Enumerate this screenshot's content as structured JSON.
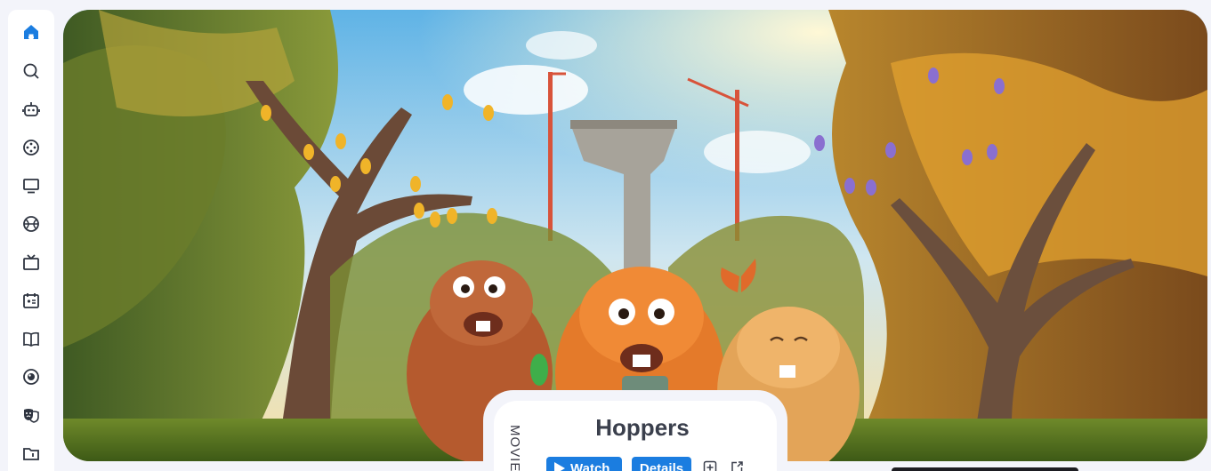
{
  "sidebar": {
    "items": [
      {
        "icon": "home-icon",
        "active": true
      },
      {
        "icon": "search-icon"
      },
      {
        "icon": "robot-icon"
      },
      {
        "icon": "film-reel-icon"
      },
      {
        "icon": "monitor-icon"
      },
      {
        "icon": "basketball-icon"
      },
      {
        "icon": "tv-icon"
      },
      {
        "icon": "calendar-card-icon"
      },
      {
        "icon": "book-icon"
      },
      {
        "icon": "anime-icon"
      },
      {
        "icon": "theater-masks-icon"
      },
      {
        "icon": "folder-icon"
      }
    ],
    "accent": "#1b7de0",
    "icon_color": "#2e3440"
  },
  "hero": {
    "image": "animated-beavers-forest-banner"
  },
  "card": {
    "type_label": "MOVIE",
    "title": "Hoppers",
    "watch_label": "Watch",
    "details_label": "Details",
    "add_icon": "add-to-list-icon",
    "share_icon": "external-link-icon"
  }
}
